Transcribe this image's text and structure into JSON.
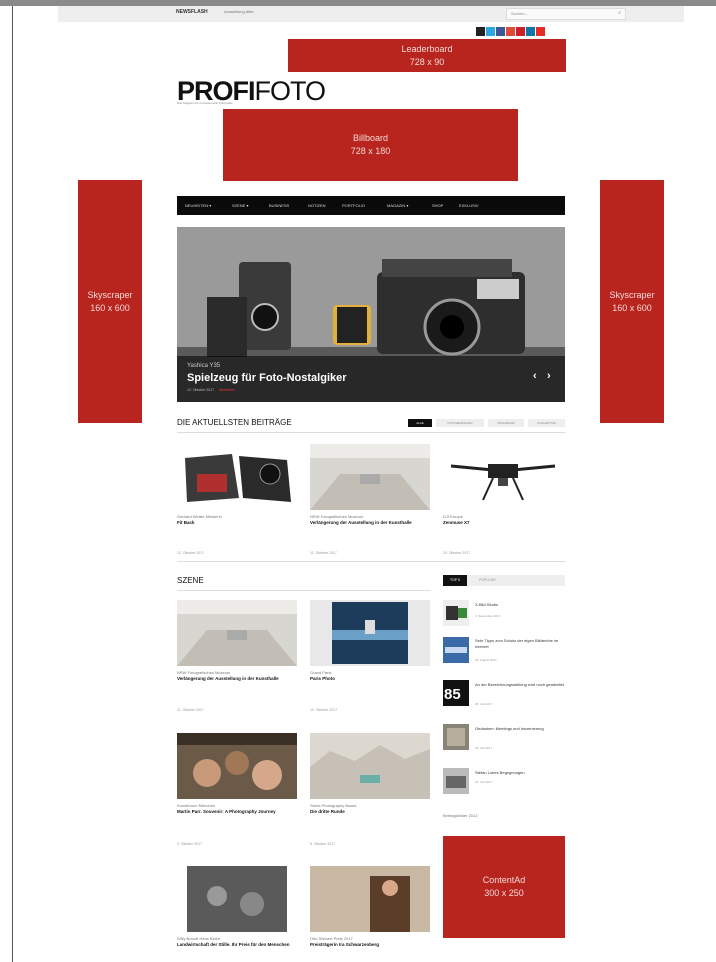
{
  "topbar": {
    "newsletter": "NEWSFLASH",
    "ticker": "Ausstellung Alter",
    "search_placeholder": "Suchen...",
    "search_icon": "search-icon"
  },
  "social_icons": [
    {
      "name": "instagram-icon",
      "color": "#222222"
    },
    {
      "name": "twitter-icon",
      "color": "#2ca7e0"
    },
    {
      "name": "facebook-icon",
      "color": "#3b5998"
    },
    {
      "name": "google-plus-icon",
      "color": "#dd4b39"
    },
    {
      "name": "pinterest-icon",
      "color": "#cb2027"
    },
    {
      "name": "linkedin-icon",
      "color": "#0e76a8"
    },
    {
      "name": "youtube-icon",
      "color": "#e52d27"
    }
  ],
  "ads": {
    "leaderboard": {
      "title": "Leaderboard",
      "size": "728 x 90"
    },
    "billboard": {
      "title": "Billboard",
      "size": "728 x 180"
    },
    "skyscraper_left": {
      "title": "Skyscraper",
      "size": "160 x 600"
    },
    "skyscraper_right": {
      "title": "Skyscraper",
      "size": "160 x 600"
    },
    "content": {
      "title": "ContentAd",
      "size": "300 x 250"
    },
    "color": "#b8241e"
  },
  "logo": {
    "bold": "PROFI",
    "light": "FOTO",
    "tagline": "Das Magazin für professionelle Fotografie"
  },
  "nav": [
    "NEUHEITEN ▾",
    "SZENE ▾",
    "BUSINESS",
    "NOTIZEN",
    "PORTFOLIO",
    "MAGAZIN ▾",
    "SHOP",
    "EXKLUSIV"
  ],
  "slider": {
    "kicker": "Yashica Y35",
    "title": "Spielzeug für Foto-Nostalgiker",
    "date": "12. Oktober 2017",
    "category": "Neuheiten",
    "prev": "‹",
    "next": "›"
  },
  "latest": {
    "heading": "DIE AKTUELLSTEN BEITRÄGE",
    "filters": [
      "ALLE",
      "FOTOLEHRGANG",
      "PANORAMA",
      "KOLLEKTIVE"
    ],
    "items": [
      {
        "kicker": "Gerhard Wetter Meisterin",
        "title": "Fit Back",
        "date": "12. Oktober 2017"
      },
      {
        "kicker": "NRW Fotografisches Museum",
        "title": "Verlängerung der Ausstellung in der Kunsthalle",
        "date": "11. Oktober 2017"
      },
      {
        "kicker": "DJI Europe",
        "title": "Zenmuse X7",
        "date": "10. Oktober 2017"
      }
    ]
  },
  "scene": {
    "heading": "SZENE",
    "items": [
      {
        "kicker": "NRW Fotografisches Museum",
        "title": "Verlängerung der Ausstellung in der Kunsthalle",
        "date": "11. Oktober 2017"
      },
      {
        "kicker": "Grand Paris",
        "title": "Paris Photo",
        "date": "10. Oktober 2017"
      },
      {
        "kicker": "Kunstforum München",
        "title": "Martin Parr. Souvenir: A Photography Journey",
        "date": "9. Oktober 2017"
      },
      {
        "kicker": "Swiss Photography Award",
        "title": "Die dritte Runde",
        "date": "8. Oktober 2017"
      },
      {
        "kicker": "Willy Brandt Haus Berlin",
        "title": "Landwirtschaft der Stille. Ihr Preis für den Menschen",
        "date": ""
      },
      {
        "kicker": "Otto Steinert Preis 2017",
        "title": "Preisträgerin Ira Schwarzenberg",
        "date": ""
      }
    ]
  },
  "sidebar": {
    "tabs": [
      "TOP 5",
      "POPULÄR"
    ],
    "items": [
      {
        "title": "X-Bild Studio",
        "date": "3. September 2017"
      },
      {
        "title": "Sehr Tipps zum Schutz der eigen Bildrechte im Internet",
        "date": "30. August 2017"
      },
      {
        "title": "An der Bezeichnungsstellung wird noch gearbeitet",
        "date": "28. Juli 2017"
      },
      {
        "title": "Gedanken: Meetings und Inszenierung",
        "date": "26. Juli 2017"
      },
      {
        "title": "Stefan Lobes Begegnungen",
        "date": "24. Juli 2017"
      }
    ],
    "footer_title": "Beitragsbilder 2012"
  }
}
